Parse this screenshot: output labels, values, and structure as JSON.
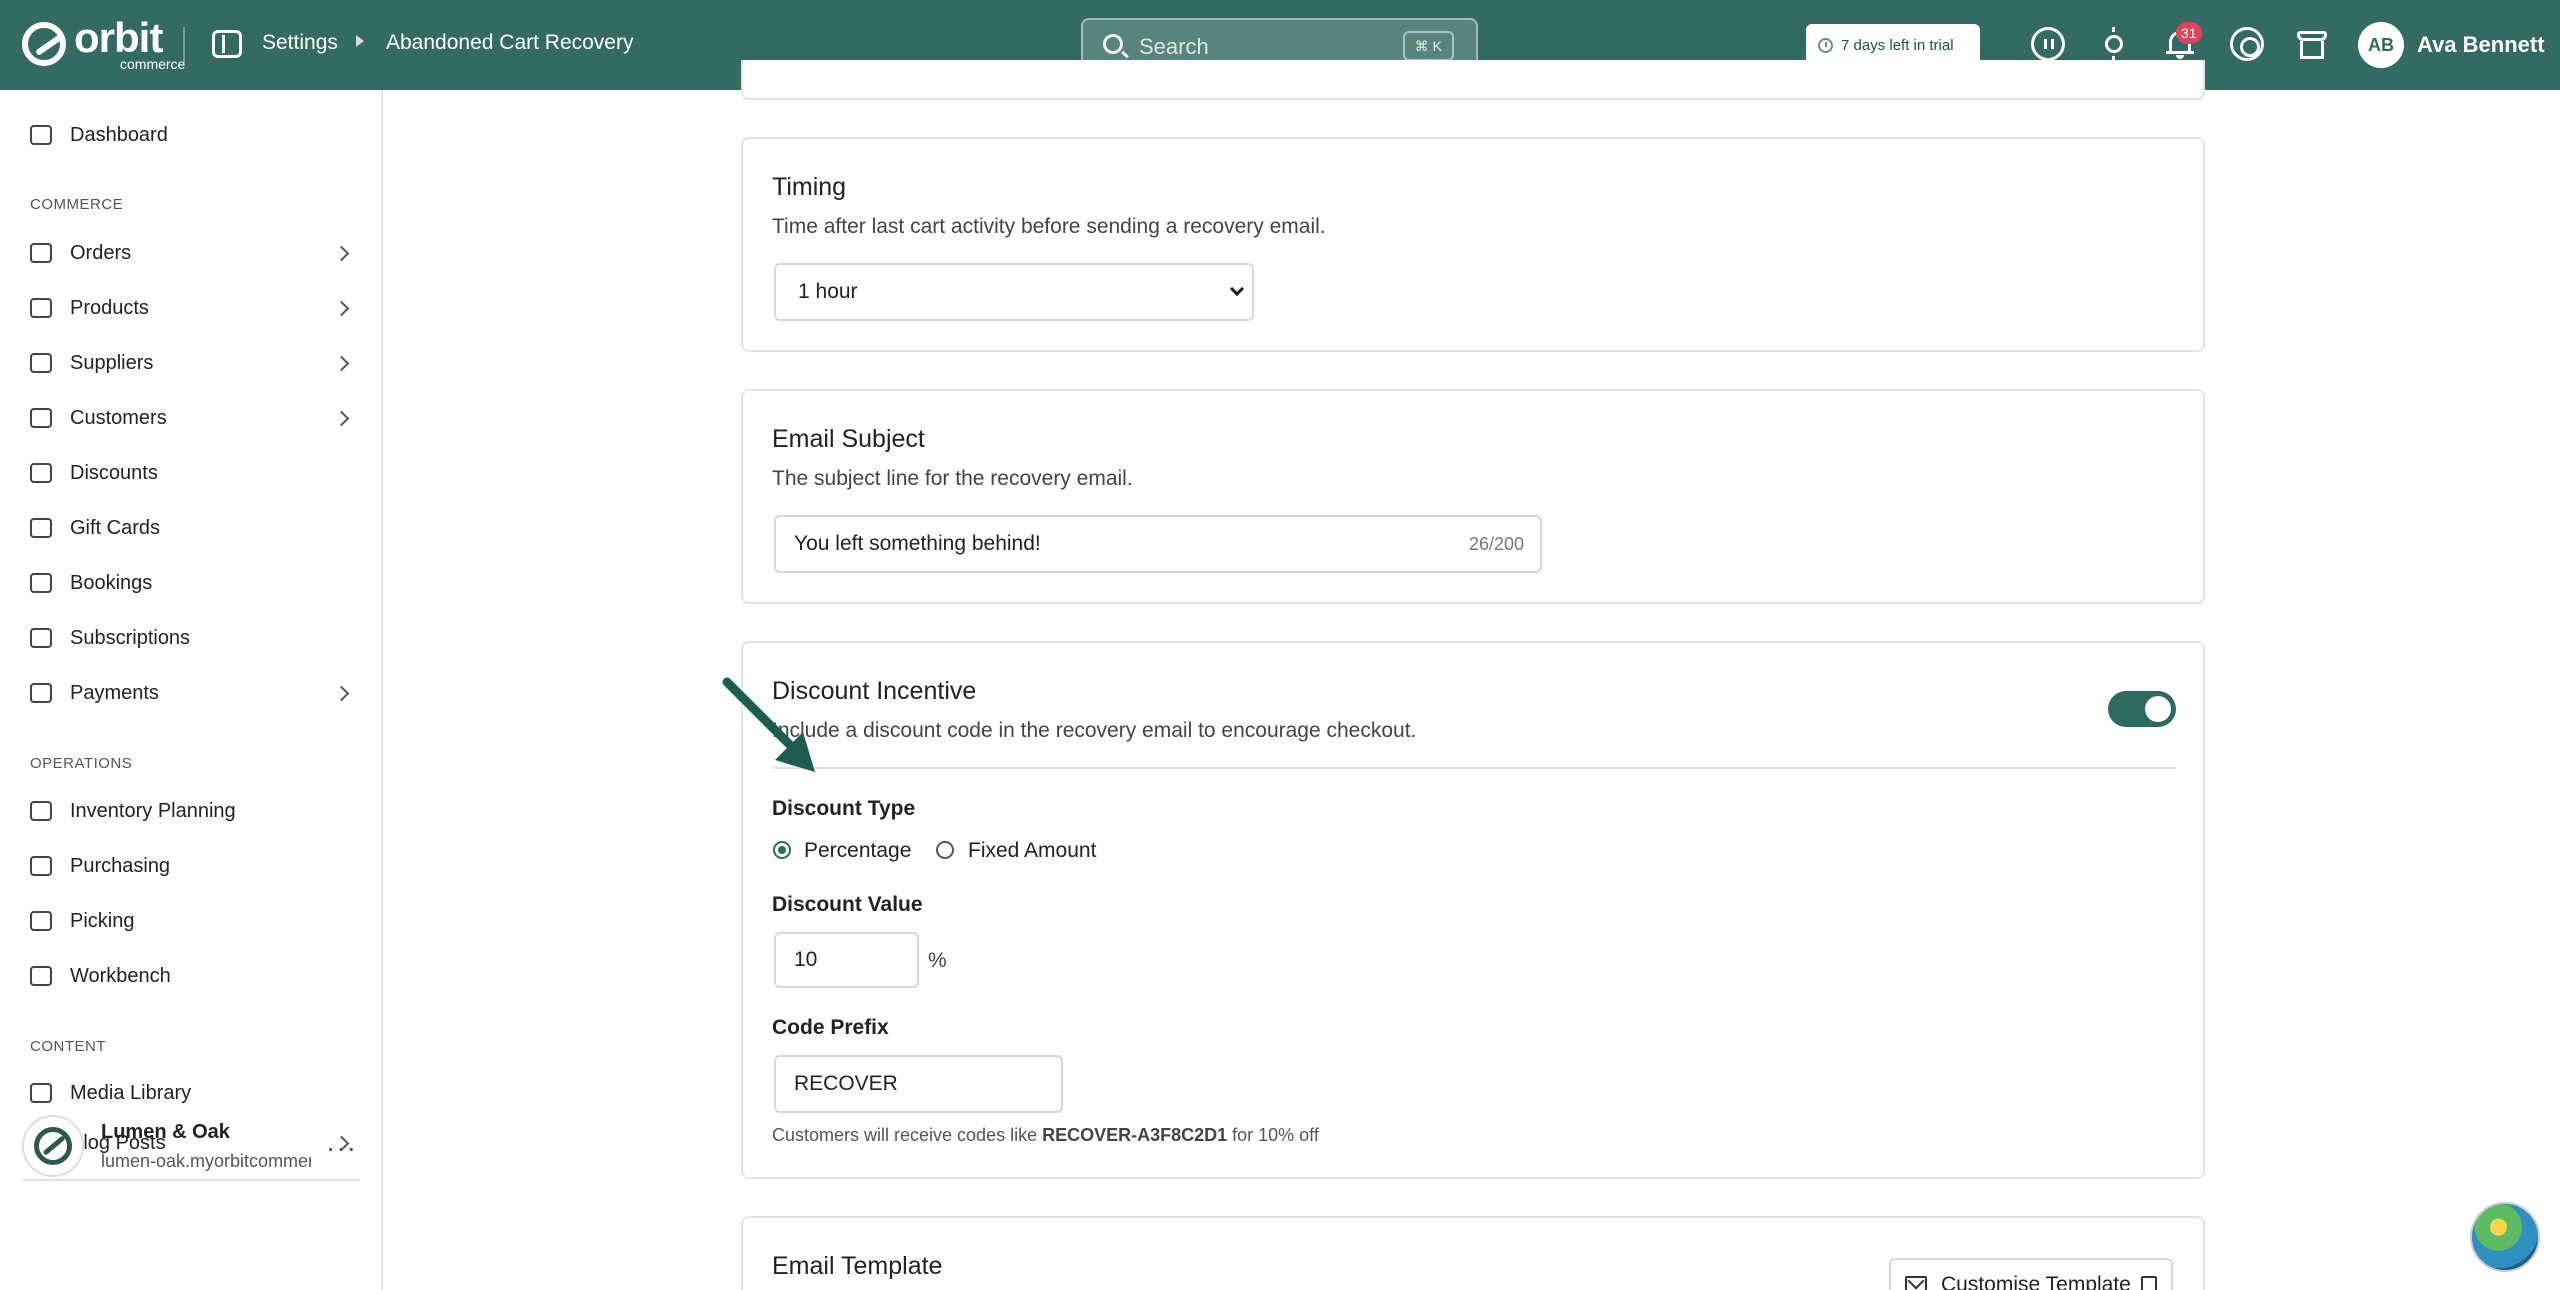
{
  "header": {
    "brand": "orbit",
    "brand_sub": "commerce",
    "breadcrumb": [
      "Settings",
      "Abandoned Cart Recovery"
    ],
    "search_placeholder": "Search",
    "search_shortcut": "⌘ K",
    "trial_text": "7 days left in trial",
    "notification_count": "31",
    "user_initials": "AB",
    "user_name": "Ava Bennett"
  },
  "sidebar": {
    "items": [
      {
        "label": "Dashboard",
        "icon": "dashboard-icon",
        "chevron": false
      },
      {
        "section": "COMMERCE"
      },
      {
        "label": "Orders",
        "icon": "orders-icon",
        "chevron": true
      },
      {
        "label": "Products",
        "icon": "box-icon",
        "chevron": true
      },
      {
        "label": "Suppliers",
        "icon": "building-icon",
        "chevron": true
      },
      {
        "label": "Customers",
        "icon": "users-icon",
        "chevron": true
      },
      {
        "label": "Discounts",
        "icon": "tag-icon",
        "chevron": false
      },
      {
        "label": "Gift Cards",
        "icon": "gift-icon",
        "chevron": false
      },
      {
        "label": "Bookings",
        "icon": "calendar-icon",
        "chevron": false
      },
      {
        "label": "Subscriptions",
        "icon": "refresh-icon",
        "chevron": false
      },
      {
        "label": "Payments",
        "icon": "card-icon",
        "chevron": true
      },
      {
        "section": "OPERATIONS"
      },
      {
        "label": "Inventory Planning",
        "icon": "clipboard-icon",
        "chevron": false
      },
      {
        "label": "Purchasing",
        "icon": "cart-icon",
        "chevron": false
      },
      {
        "label": "Picking",
        "icon": "pin-icon",
        "chevron": false
      },
      {
        "label": "Workbench",
        "icon": "cube-icon",
        "chevron": false
      },
      {
        "section": "CONTENT"
      },
      {
        "label": "Media Library",
        "icon": "image-icon",
        "chevron": false
      },
      {
        "label": "Blog Posts",
        "icon": "document-icon",
        "chevron": true
      }
    ],
    "store_name": "Lumen & Oak",
    "store_url": "lumen-oak.myorbitcommerce.com"
  },
  "timing": {
    "title": "Timing",
    "description": "Time after last cart activity before sending a recovery email.",
    "selected": "1 hour"
  },
  "email_subject": {
    "title": "Email Subject",
    "description": "The subject line for the recovery email.",
    "value": "You left something behind!",
    "counter": "26/200"
  },
  "discount": {
    "title": "Discount Incentive",
    "description": "Include a discount code in the recovery email to encourage checkout.",
    "enabled": true,
    "type_label": "Discount Type",
    "type_options": [
      "Percentage",
      "Fixed Amount"
    ],
    "type_selected": "Percentage",
    "value_label": "Discount Value",
    "value": "10",
    "value_unit": "%",
    "prefix_label": "Code Prefix",
    "prefix": "RECOVER",
    "helper_before": "Customers will receive codes like ",
    "helper_code": "RECOVER-A3F8C2D1",
    "helper_after": " for 10% off"
  },
  "email_template": {
    "title": "Email Template",
    "button_label": "Customise Template"
  },
  "colors": {
    "brand": "#336a61",
    "accent": "#2f6a60",
    "badge": "#e0435d"
  }
}
